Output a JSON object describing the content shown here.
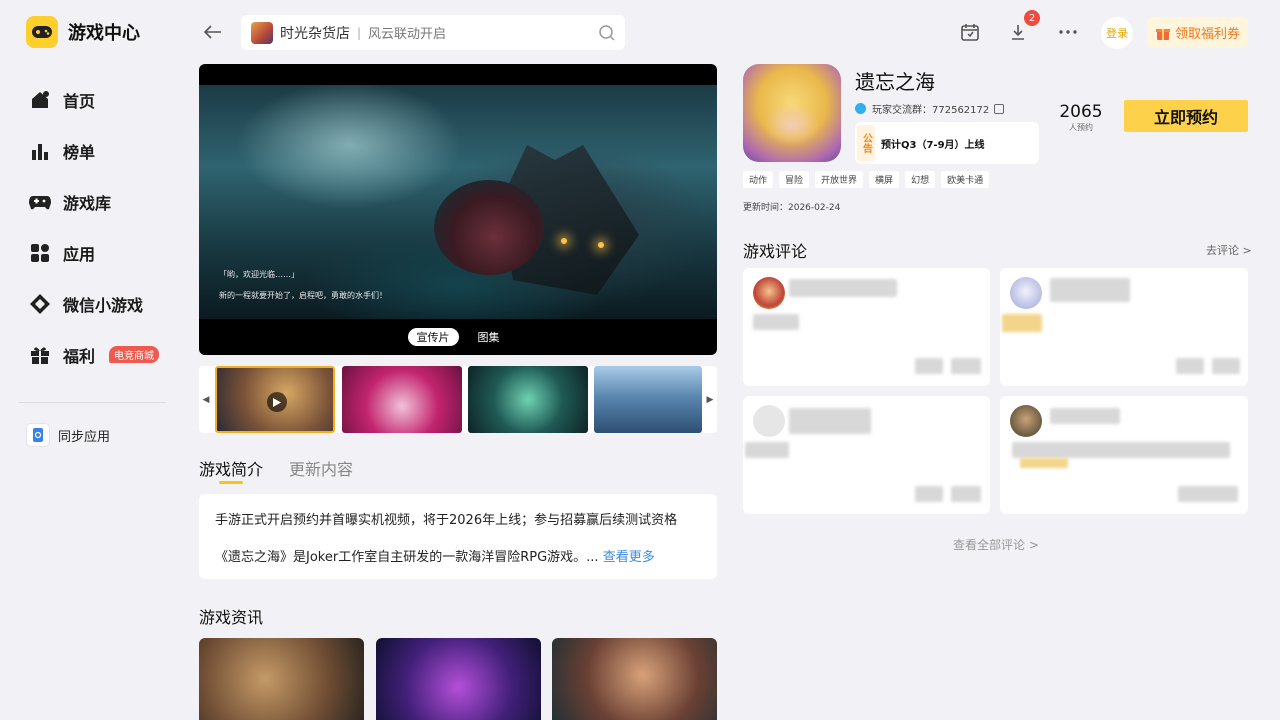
{
  "app": {
    "title": "游戏中心"
  },
  "sidebar": {
    "items": [
      {
        "label": "首页",
        "icon": "home-icon"
      },
      {
        "label": "榜单",
        "icon": "ranking-icon"
      },
      {
        "label": "游戏库",
        "icon": "gamepad-icon"
      },
      {
        "label": "应用",
        "icon": "apps-icon"
      },
      {
        "label": "微信小游戏",
        "icon": "mini-game-icon"
      },
      {
        "label": "福利",
        "icon": "gift-icon",
        "badge": "电竞商城"
      }
    ],
    "sync_label": "同步应用"
  },
  "search": {
    "game": "时光杂货店",
    "separator": "|",
    "sub": "风云联动开启"
  },
  "topbar": {
    "download_count": "2",
    "login_label": "登录",
    "coupon_label": "领取福利券"
  },
  "video": {
    "subtitle1": "「哟，欢迎光临……」",
    "subtitle2": "新的一程就要开始了，启程吧，勇敢的水手们！",
    "tabs": [
      {
        "label": "宣传片",
        "active": true
      },
      {
        "label": "图集",
        "active": false
      }
    ]
  },
  "intro": {
    "tabs": [
      {
        "label": "游戏简介",
        "active": true
      },
      {
        "label": "更新内容",
        "active": false
      }
    ],
    "para1": "手游正式开启预约并首曝实机视频，将于2026年上线；参与招募赢后续测试资格",
    "para2": "《遗忘之海》是Joker工作室自主研发的一款海洋冒险RPG游戏。...",
    "more": "查看更多"
  },
  "news": {
    "title": "游戏资讯"
  },
  "game": {
    "name": "遗忘之海",
    "group": "玩家交流群：772562172",
    "notice_tag": "公告",
    "notice": "预计Q3（7-9月）上线",
    "count": "2065",
    "count_label": "人预约",
    "reserve_label": "立即预约",
    "tags": [
      "动作",
      "冒险",
      "开放世界",
      "横屏",
      "幻想",
      "欧美卡通"
    ],
    "updated": "更新时间：2026-02-24"
  },
  "reviews": {
    "title": "游戏评论",
    "go_link": "去评论 >",
    "view_all": "查看全部评论 >"
  },
  "colors": {
    "accent": "#fdd14a",
    "badge": "#f04a3e",
    "link": "#3d8ae0",
    "coupon": "#ee7a1f"
  }
}
